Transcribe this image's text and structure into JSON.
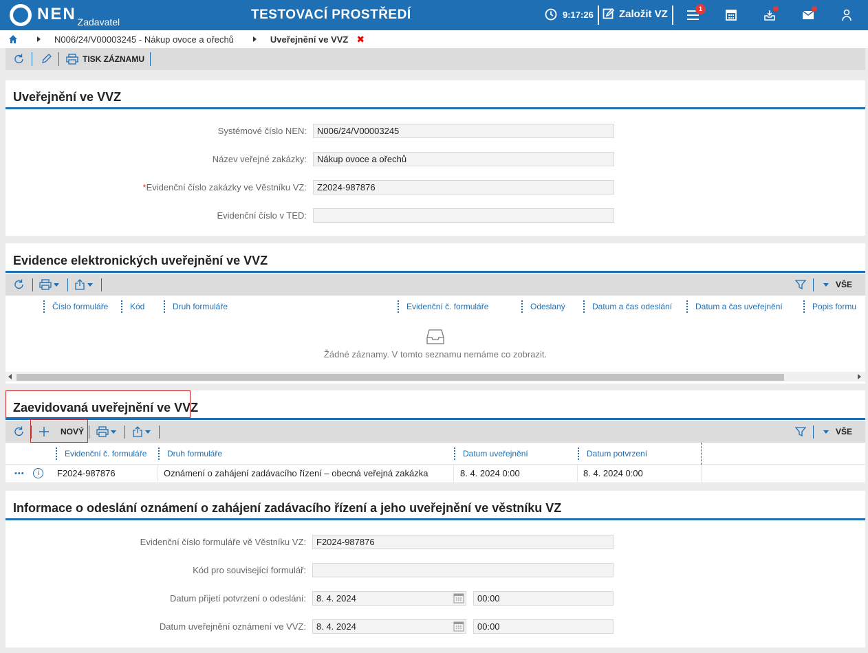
{
  "header": {
    "logo_text": "NEN",
    "logo_sub": "Zadavatel",
    "env_title": "TESTOVACÍ PROSTŘEDÍ",
    "clock_icon": "clock-icon",
    "time": "9:17:26",
    "create_label": "Založit VZ",
    "menu_badge": "1",
    "icons": [
      "menu-icon",
      "calculator-icon",
      "inbox-tray-icon",
      "mail-icon",
      "user-icon"
    ]
  },
  "breadcrumb": {
    "items": [
      "N006/24/V00003245 - Nákup ovoce a ořechů",
      "Uveřejnění ve VVZ"
    ],
    "close_symbol": "✖"
  },
  "toolbar": {
    "print_label": "TISK ZÁZNAMU"
  },
  "section1": {
    "title": "Uveřejnění ve VVZ",
    "fields": [
      {
        "label": "Systémové číslo NEN:",
        "value": "N006/24/V00003245",
        "required": false
      },
      {
        "label": "Název veřejné zakázky:",
        "value": "Nákup ovoce a ořechů",
        "required": false
      },
      {
        "label": "Evidenční číslo zakázky ve Věstníku VZ:",
        "value": "Z2024-987876",
        "required": true,
        "req_mark": "*"
      },
      {
        "label": "Evidenční číslo v TED:",
        "value": "",
        "required": false
      }
    ]
  },
  "section2": {
    "title": "Evidence elektronických uveřejnění ve VVZ",
    "filter_all": "VŠE",
    "columns": [
      "Číslo formuláře",
      "Kód",
      "Druh formuláře",
      "Evidenční č. formuláře",
      "Odeslaný",
      "Datum a čas odeslání",
      "Datum a čas uveřejnění",
      "Popis formu"
    ],
    "empty_text": "Žádné záznamy. V tomto seznamu nemáme co zobrazit."
  },
  "section3": {
    "title": "Zaevidovaná uveřejnění ve VVZ",
    "new_label": "NOVÝ",
    "filter_all": "VŠE",
    "columns": [
      "Evidenční č. formuláře",
      "Druh formuláře",
      "Datum uveřejnění",
      "Datum potvrzení"
    ],
    "rows": [
      {
        "actions": "•••",
        "info": "i",
        "form_no": "F2024-987876",
        "form_type": "Oznámení o zahájení zadávacího řízení – obecná veřejná zakázka",
        "published": "8. 4. 2024 0:00",
        "confirmed": "8. 4. 2024 0:00"
      }
    ]
  },
  "section4": {
    "title": "Informace o odeslání oznámení o zahájení zadávacího řízení a jeho uveřejnění ve věstníku VZ",
    "fields": [
      {
        "label": "Evidenční číslo formuláře vě Věstníku VZ:",
        "value": "F2024-987876"
      },
      {
        "label": "Kód pro související formulář:",
        "value": ""
      },
      {
        "label": "Datum přijetí potvrzení o odeslání:",
        "date": "8. 4. 2024",
        "time": "00:00"
      },
      {
        "label": "Datum uveřejnění oznámení ve VVZ:",
        "date": "8. 4. 2024",
        "time": "00:00"
      }
    ]
  }
}
